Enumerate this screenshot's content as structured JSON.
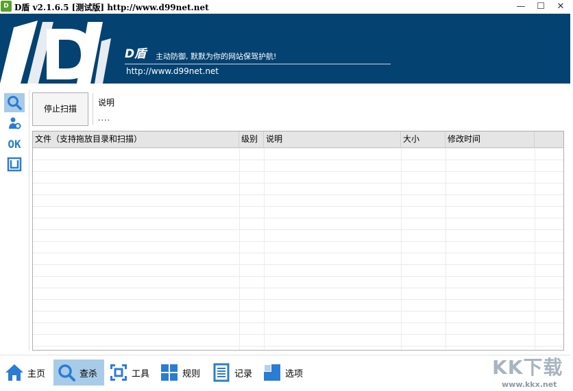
{
  "window": {
    "title": "D盾 v2.1.6.5 [测试版] http://www.d99net.net",
    "app_icon_text": "D盾",
    "minimize": "—",
    "maximize": "☐",
    "close": "✕"
  },
  "banner": {
    "brand": "D盾",
    "slogan": "主动防御, 默默为你的网站保驾护航!",
    "url": "http://www.d99net.net",
    "background_color": "#044272"
  },
  "left_toolbar": {
    "items": [
      {
        "icon": "search-icon",
        "active": true
      },
      {
        "icon": "user-process-icon",
        "active": false
      },
      {
        "icon": "ok-icon",
        "text": "OK",
        "active": false
      },
      {
        "icon": "frame-icon",
        "active": false
      }
    ]
  },
  "scan": {
    "stop_button": "停止扫描",
    "desc_label": "说明",
    "desc_value": "...."
  },
  "table": {
    "columns": [
      "文件（支持拖放目录和扫描）",
      "级别",
      "说明",
      "大小",
      "修改时间"
    ],
    "rows": []
  },
  "bottom_nav": {
    "items": [
      {
        "label": "主页",
        "icon": "home-icon",
        "active": false
      },
      {
        "label": "查杀",
        "icon": "search-icon",
        "active": true
      },
      {
        "label": "工具",
        "icon": "tools-icon",
        "active": false
      },
      {
        "label": "规则",
        "icon": "rules-icon",
        "active": false
      },
      {
        "label": "记录",
        "icon": "log-icon",
        "active": false
      },
      {
        "label": "选项",
        "icon": "options-icon",
        "active": false
      }
    ]
  },
  "watermark": {
    "text": "KK下载",
    "url": "www.kkx.net"
  },
  "colors": {
    "accent": "#2b7cd3",
    "active_bg": "#a8cbe8"
  }
}
